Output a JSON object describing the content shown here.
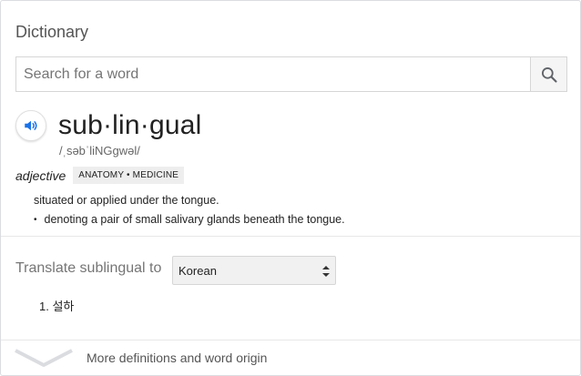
{
  "dictionary": {
    "heading": "Dictionary",
    "search": {
      "placeholder": "Search for a word",
      "value": ""
    },
    "entry": {
      "word": "sub·lin·gual",
      "phonetic": "/ˌsəbˈliNGɡwəl/",
      "part_of_speech": "adjective",
      "labels": "ANATOMY • MEDICINE",
      "definition": "situated or applied under the tongue.",
      "sub_definition": "denoting a pair of small salivary glands beneath the tongue."
    },
    "translate": {
      "label": "Translate sublingual to",
      "selected_language": "Korean",
      "result_number": "1.",
      "result_text": "설하"
    },
    "more": {
      "label": "More definitions and word origin"
    }
  },
  "icons": {
    "search": "search-icon",
    "speaker": "speaker-icon",
    "select_arrows": "select-arrows-icon",
    "chevron": "chevron-down-icon"
  },
  "colors": {
    "accent": "#1a73e8",
    "chip_bg": "#eeeeee",
    "muted_text": "#757575"
  }
}
